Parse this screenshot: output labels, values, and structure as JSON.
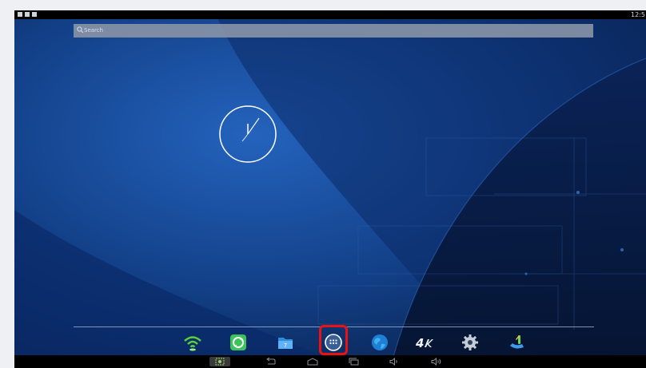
{
  "status_bar": {
    "time": "12:5",
    "left_icons": [
      "notification-icon",
      "image-icon",
      "download-icon"
    ]
  },
  "search": {
    "placeholder": "Search",
    "icon": "search-icon"
  },
  "clock_widget": {
    "type": "analog-clock"
  },
  "dock": {
    "items": [
      {
        "name": "wifi-app",
        "icon": "wifi-icon"
      },
      {
        "name": "sync-app",
        "icon": "sync-icon"
      },
      {
        "name": "file-manager-app",
        "icon": "file-manager-icon"
      },
      {
        "name": "all-apps",
        "icon": "apps-grid-icon",
        "highlighted": true
      },
      {
        "name": "browser-app",
        "icon": "globe-icon"
      },
      {
        "name": "4k-player-app",
        "icon": "4k-icon"
      },
      {
        "name": "settings-app",
        "icon": "gear-icon"
      },
      {
        "name": "miracast-app",
        "icon": "cast-icon"
      }
    ]
  },
  "nav_bar": {
    "buttons": [
      "screenshot-icon",
      "back-icon",
      "home-icon",
      "recents-icon",
      "volume-down-icon",
      "volume-up-icon"
    ]
  },
  "colors": {
    "highlight": "#ee1111",
    "wallpaper_dark": "#0c2c63",
    "wallpaper_light": "#1d5cb0"
  }
}
